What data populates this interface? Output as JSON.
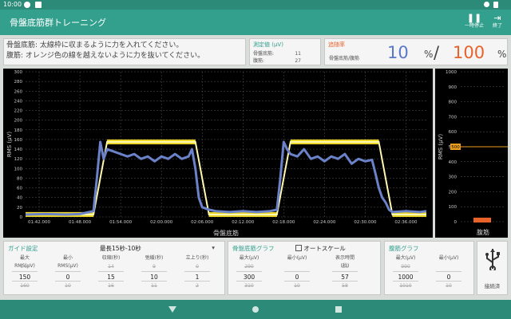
{
  "status": {
    "time": "10:00"
  },
  "app": {
    "title": "骨盤底筋群トレーニング",
    "pause_label": "一時停止",
    "end_label": "終了"
  },
  "instructions": {
    "line1": "骨盤底筋: 太線枠に収まるように力を入れてください。",
    "line2": "腹筋: オレンジ色の線を越えないように力を抜いてください。"
  },
  "measured": {
    "header": "測定値 (μV)",
    "pelvic_label": "骨盤底筋:",
    "pelvic_value": "11",
    "abdominal_label": "腹筋:",
    "abdominal_value": "27"
  },
  "achievement": {
    "header": "追随率",
    "sub": "骨盤底筋/腹筋",
    "pelvic": "10",
    "unit1": "%",
    "slash": "/",
    "abdominal": "100",
    "unit2": "%"
  },
  "chart_data": [
    {
      "type": "line",
      "ylabel": "RMS (μV)",
      "xlabel": "骨盤底筋",
      "ylim": [
        0,
        300
      ],
      "y_ticks": [
        "0",
        "20",
        "40",
        "60",
        "80",
        "100",
        "120",
        "140",
        "160",
        "180",
        "200",
        "220",
        "240",
        "260",
        "280",
        "300"
      ],
      "x_ticks": [
        "01:42.000",
        "01:48.000",
        "01:54.000",
        "02:00.000",
        "02:06.000",
        "02:12.000",
        "02:18.000",
        "02:24.000",
        "02:30.000",
        "02:36.000"
      ],
      "x_range_seconds": [
        100,
        159
      ],
      "guide_band_color": "#f5e22b",
      "series_color": "#6b82c9",
      "guide_upper": [
        [
          100,
          10
        ],
        [
          110,
          10
        ],
        [
          112,
          160
        ],
        [
          125,
          160
        ],
        [
          127,
          10
        ],
        [
          137,
          10
        ],
        [
          139,
          160
        ],
        [
          152,
          160
        ],
        [
          154,
          10
        ],
        [
          159,
          10
        ]
      ],
      "guide_lower": [
        [
          100,
          0
        ],
        [
          110,
          0
        ],
        [
          112,
          150
        ],
        [
          125,
          150
        ],
        [
          127,
          0
        ],
        [
          137,
          0
        ],
        [
          139,
          150
        ],
        [
          152,
          150
        ],
        [
          154,
          0
        ],
        [
          159,
          0
        ]
      ],
      "series": [
        {
          "values": [
            [
              100,
              5
            ],
            [
              103,
              6
            ],
            [
              106,
              5
            ],
            [
              108,
              6
            ],
            [
              110,
              12
            ],
            [
              110.5,
              80
            ],
            [
              111,
              155
            ],
            [
              111.5,
              120
            ],
            [
              112,
              140
            ],
            [
              113,
              135
            ],
            [
              114,
              130
            ],
            [
              115,
              125
            ],
            [
              116,
              130
            ],
            [
              117,
              120
            ],
            [
              118,
              125
            ],
            [
              119,
              115
            ],
            [
              120,
              125
            ],
            [
              121,
              120
            ],
            [
              122,
              130
            ],
            [
              123,
              120
            ],
            [
              124,
              125
            ],
            [
              124.5,
              140
            ],
            [
              125,
              100
            ],
            [
              125.5,
              40
            ],
            [
              126,
              20
            ],
            [
              127,
              15
            ],
            [
              128,
              12
            ],
            [
              130,
              10
            ],
            [
              132,
              12
            ],
            [
              134,
              10
            ],
            [
              136,
              12
            ],
            [
              137,
              15
            ],
            [
              137.5,
              80
            ],
            [
              138,
              155
            ],
            [
              138.5,
              140
            ],
            [
              139,
              130
            ],
            [
              140,
              125
            ],
            [
              141,
              140
            ],
            [
              142,
              120
            ],
            [
              143,
              125
            ],
            [
              144,
              115
            ],
            [
              145,
              125
            ],
            [
              146,
              120
            ],
            [
              147,
              130
            ],
            [
              148,
              110
            ],
            [
              149,
              120
            ],
            [
              150,
              115
            ],
            [
              151,
              118
            ],
            [
              151.5,
              90
            ],
            [
              152,
              60
            ],
            [
              152.5,
              40
            ],
            [
              153,
              30
            ],
            [
              153.5,
              15
            ],
            [
              154,
              10
            ],
            [
              156,
              12
            ],
            [
              158,
              10
            ],
            [
              159,
              12
            ]
          ]
        }
      ]
    },
    {
      "type": "bar",
      "xlabel": "腹筋",
      "ylabel": "RMS (μV)",
      "ylim": [
        0,
        1000
      ],
      "y_ticks": [
        "0",
        "100",
        "200",
        "300",
        "400",
        "500",
        "600",
        "700",
        "800",
        "900",
        "1000"
      ],
      "threshold": 500,
      "threshold_label": "500",
      "value": 27,
      "color": "#e8622a"
    }
  ],
  "guide": {
    "header": "ガイド設定",
    "mode": "最長15秒-10秒",
    "cols": [
      {
        "label": "最大RMS(μV)",
        "prev": "140",
        "value": "150",
        "next": "160"
      },
      {
        "label": "最小RMS(μV)",
        "prev": "",
        "value": "0",
        "next": "10"
      },
      {
        "label": "収縮(秒)",
        "prev": "14",
        "value": "15",
        "next": "16"
      },
      {
        "label": "弛緩(秒)",
        "prev": "9",
        "value": "10",
        "next": "11"
      },
      {
        "label": "立上り(秒)",
        "prev": "0",
        "value": "1",
        "next": "2"
      }
    ]
  },
  "pgraph": {
    "header": "骨盤底筋グラフ",
    "autoscale": "オートスケール",
    "cols": [
      {
        "label": "最大(μV)",
        "prev": "290",
        "value": "300",
        "next": "310"
      },
      {
        "label": "最小(μV)",
        "prev": "",
        "value": "0",
        "next": "10"
      },
      {
        "label": "表示時間(秒)",
        "prev": "56",
        "value": "57",
        "next": "58"
      }
    ]
  },
  "agraph": {
    "header": "腹筋グラフ",
    "cols": [
      {
        "label": "最大(μV)",
        "prev": "990",
        "value": "1000",
        "next": "1010"
      },
      {
        "label": "最小(μV)",
        "prev": "",
        "value": "0",
        "next": "10"
      }
    ]
  },
  "usb": {
    "label": "接続済"
  }
}
